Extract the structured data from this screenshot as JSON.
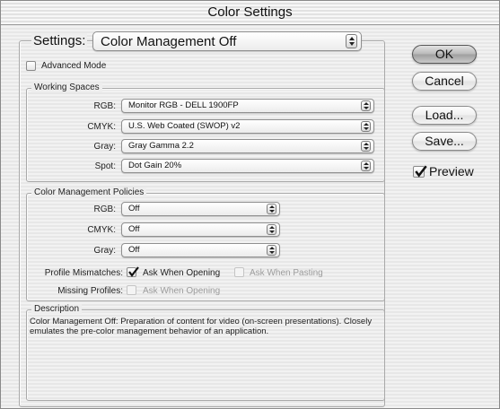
{
  "window": {
    "title": "Color Settings"
  },
  "settings": {
    "label": "Settings:",
    "value": "Color Management Off"
  },
  "advanced_mode": {
    "label": "Advanced Mode",
    "checked": false
  },
  "working_spaces": {
    "title": "Working Spaces",
    "rows": [
      {
        "label": "RGB:",
        "value": "Monitor RGB - DELL 1900FP"
      },
      {
        "label": "CMYK:",
        "value": "U.S. Web Coated (SWOP) v2"
      },
      {
        "label": "Gray:",
        "value": "Gray Gamma 2.2"
      },
      {
        "label": "Spot:",
        "value": "Dot Gain 20%"
      }
    ]
  },
  "policies": {
    "title": "Color Management Policies",
    "rows": [
      {
        "label": "RGB:",
        "value": "Off"
      },
      {
        "label": "CMYK:",
        "value": "Off"
      },
      {
        "label": "Gray:",
        "value": "Off"
      }
    ],
    "profile_mismatches": {
      "label": "Profile Mismatches:",
      "ask_opening": {
        "label": "Ask When Opening",
        "checked": true
      },
      "ask_pasting": {
        "label": "Ask When Pasting",
        "checked": false,
        "enabled": false
      }
    },
    "missing_profiles": {
      "label": "Missing Profiles:",
      "ask_opening": {
        "label": "Ask When Opening",
        "checked": false,
        "enabled": false
      }
    }
  },
  "description": {
    "title": "Description",
    "text": "Color Management Off: Preparation of content for video (on-screen presentations). Closely emulates the pre-color management behavior of an application."
  },
  "buttons": {
    "ok": "OK",
    "cancel": "Cancel",
    "load": "Load...",
    "save": "Save..."
  },
  "preview": {
    "label": "Preview",
    "checked": true
  }
}
